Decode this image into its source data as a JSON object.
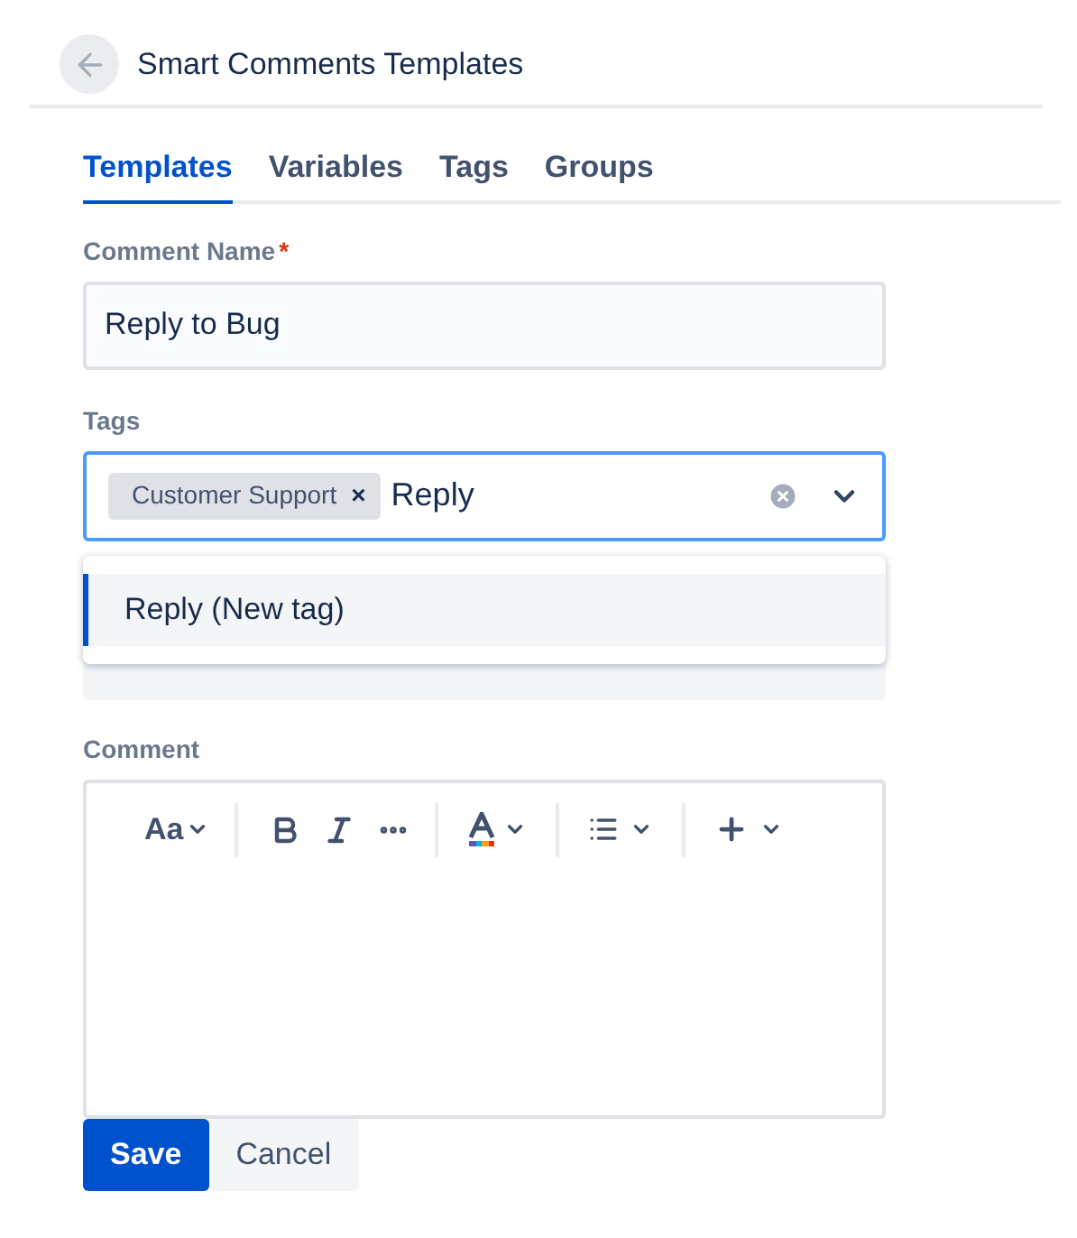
{
  "header": {
    "title": "Smart Comments Templates"
  },
  "tabs": [
    {
      "label": "Templates",
      "selected": true
    },
    {
      "label": "Variables",
      "selected": false
    },
    {
      "label": "Tags",
      "selected": false
    },
    {
      "label": "Groups",
      "selected": false
    }
  ],
  "comment_name": {
    "label": "Comment Name",
    "required_mark": "*",
    "value": "Reply to Bug"
  },
  "tags": {
    "label": "Tags",
    "chips": [
      "Customer Support"
    ],
    "remove_mark": "×",
    "value": "Reply",
    "dropdown": [
      {
        "label": "Reply (New tag)",
        "selected": true
      }
    ]
  },
  "comment": {
    "label": "Comment",
    "text_style": "Aa"
  },
  "buttons": [
    {
      "label": "Save",
      "kind": "primary"
    },
    {
      "label": "Cancel",
      "kind": "secondary"
    }
  ]
}
